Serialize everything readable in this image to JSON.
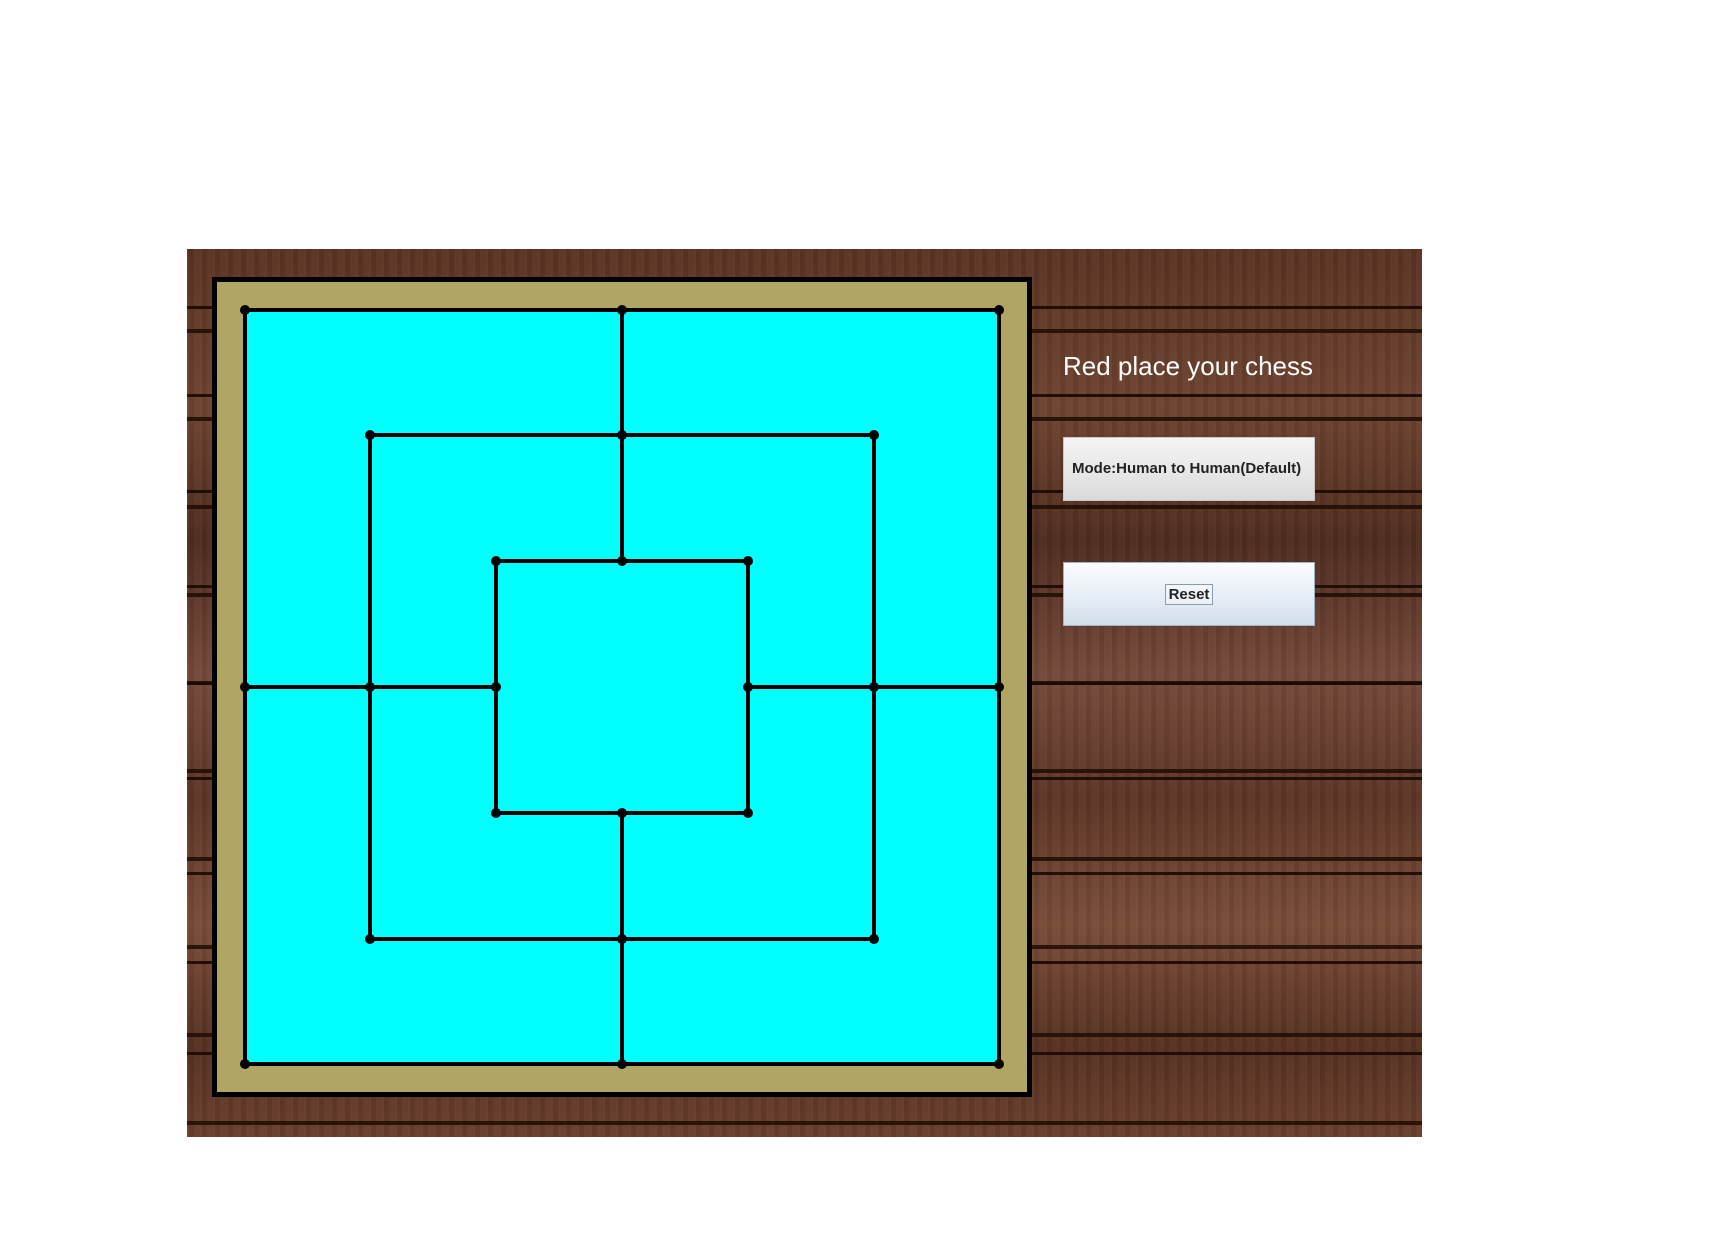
{
  "window": {
    "background": "wood-planks"
  },
  "board": {
    "frame_color": "#b0a563",
    "field_color": "#00ffff",
    "line_color": "#000000",
    "border_color": "#000000",
    "rings": [
      "outer",
      "middle",
      "inner"
    ],
    "pieces": []
  },
  "sidebar": {
    "status": "Red place your chess",
    "mode_button_label": "Mode:Human to Human(Default)",
    "reset_button_label": "Reset"
  }
}
